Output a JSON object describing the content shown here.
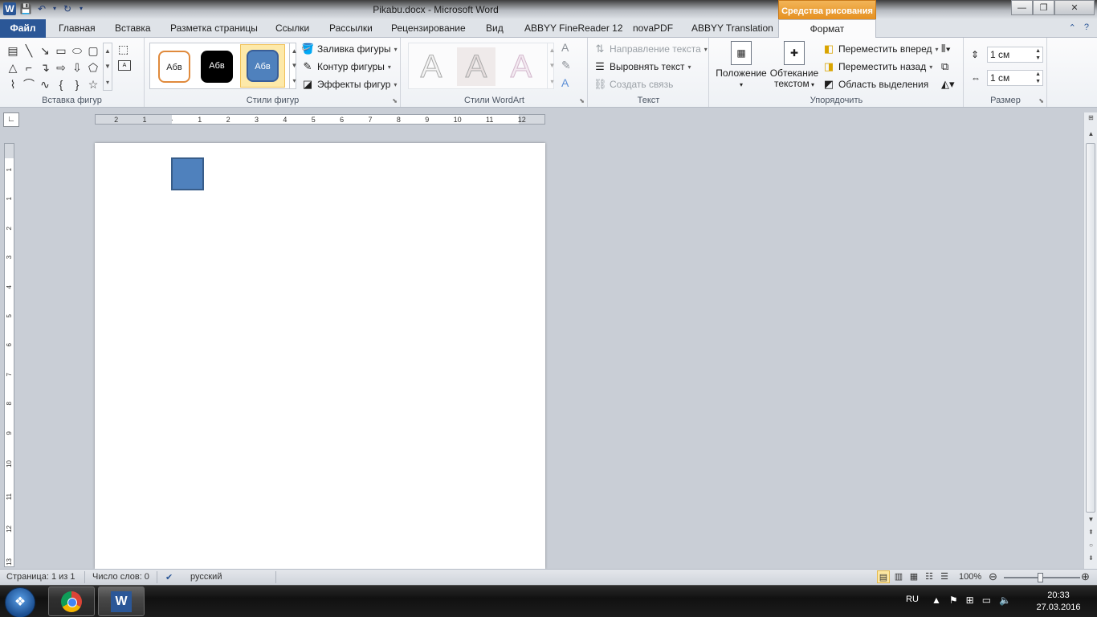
{
  "window": {
    "title": "Pikabu.docx  -  Microsoft Word",
    "contextual_tab_group": "Средства рисования",
    "minimize": "—",
    "maximize": "❐",
    "close": "✕"
  },
  "tabs": {
    "file": "Файл",
    "items": [
      "Главная",
      "Вставка",
      "Разметка страницы",
      "Ссылки",
      "Рассылки",
      "Рецензирование",
      "Вид",
      "ABBYY FineReader 12",
      "novaPDF",
      "ABBYY Translation"
    ],
    "format": "Формат"
  },
  "ribbon": {
    "insert_shapes": {
      "label": "Вставка фигур"
    },
    "shape_styles": {
      "label": "Стили фигур",
      "style_sample": "Абв",
      "fill": "Заливка фигуры",
      "outline": "Контур фигуры",
      "effects": "Эффекты фигур"
    },
    "wordart_styles": {
      "label": "Стили WordArt",
      "letter": "A"
    },
    "text": {
      "label": "Текст",
      "direction": "Направление текста",
      "align": "Выровнять текст",
      "link": "Создать связь"
    },
    "arrange": {
      "label": "Упорядочить",
      "position": "Положение",
      "wrap_line1": "Обтекание",
      "wrap_line2": "текстом",
      "bring_forward": "Переместить вперед",
      "send_backward": "Переместить назад",
      "selection_pane": "Область выделения"
    },
    "size": {
      "label": "Размер",
      "height": "1 см",
      "width": "1 см"
    }
  },
  "ruler": {
    "horizontal": [
      "2",
      "1",
      "",
      "1",
      "2",
      "3",
      "4",
      "5",
      "6",
      "7",
      "8",
      "9",
      "10",
      "11",
      "12"
    ],
    "vertical": [
      "1",
      "1",
      "2",
      "3",
      "4",
      "5",
      "6",
      "7",
      "8",
      "9",
      "10",
      "11",
      "12",
      "13"
    ]
  },
  "statusbar": {
    "page": "Страница: 1 из 1",
    "words": "Число слов: 0",
    "language": "русский",
    "zoom": "100%",
    "zoom_level": 1.0
  },
  "taskbar": {
    "lang": "RU",
    "time": "20:33",
    "date": "27.03.2016"
  },
  "colors": {
    "shape_fill": "#4f81bd",
    "shape_outline": "#385d8a",
    "file_tab": "#2b5797",
    "contextual_tab": "#e58f1e"
  },
  "icons": [
    "word-icon",
    "save-icon",
    "undo-icon",
    "redo-icon",
    "help-icon",
    "chrome-icon",
    "start-icon"
  ]
}
